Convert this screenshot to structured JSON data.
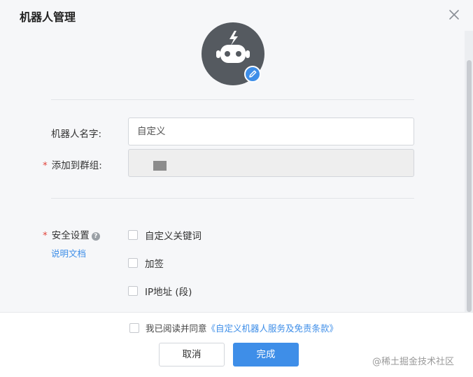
{
  "dialog": {
    "title": "机器人管理"
  },
  "form": {
    "name_label": "机器人名字:",
    "name_placeholder": "自定义",
    "group_label": "添加到群组:",
    "required_mark": "*",
    "security_label": "安全设置",
    "help_glyph": "?",
    "doc_link": "说明文档",
    "security_options": [
      "自定义关键词",
      "加签",
      "IP地址 (段)"
    ]
  },
  "footer": {
    "agree_prefix": "我已阅读并同意",
    "agree_link": "《自定义机器人服务及免责条款》",
    "cancel_label": "取消",
    "done_label": "完成",
    "watermark": "@稀土掘金技术社区"
  },
  "icons": {
    "close": "close-icon",
    "avatar": "robot-avatar-icon",
    "edit": "pencil-icon",
    "help": "question-circle-icon"
  },
  "colors": {
    "accent": "#3e8ee8",
    "required": "#e2453c",
    "avatar_bg": "#555a60"
  }
}
